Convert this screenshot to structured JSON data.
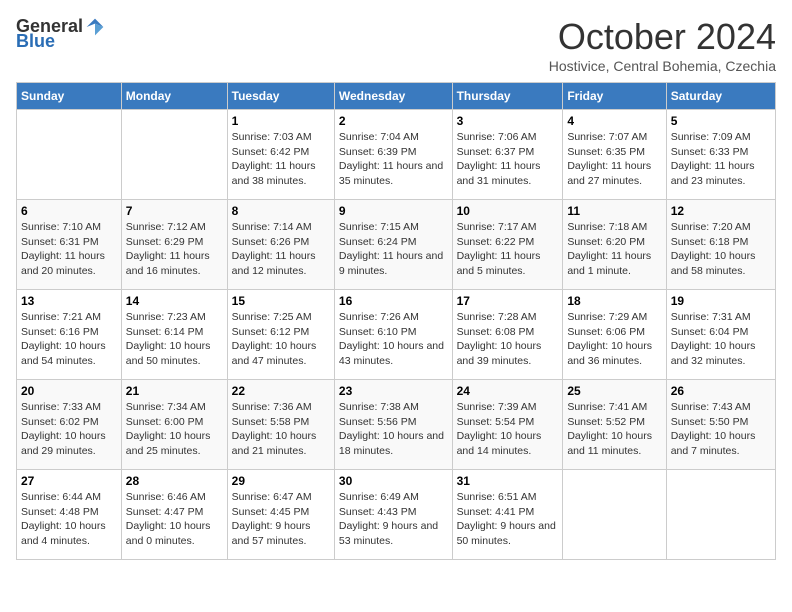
{
  "header": {
    "logo_general": "General",
    "logo_blue": "Blue",
    "month_title": "October 2024",
    "subtitle": "Hostivice, Central Bohemia, Czechia"
  },
  "days_of_week": [
    "Sunday",
    "Monday",
    "Tuesday",
    "Wednesday",
    "Thursday",
    "Friday",
    "Saturday"
  ],
  "weeks": [
    [
      {
        "day": "",
        "info": ""
      },
      {
        "day": "",
        "info": ""
      },
      {
        "day": "1",
        "info": "Sunrise: 7:03 AM\nSunset: 6:42 PM\nDaylight: 11 hours and 38 minutes."
      },
      {
        "day": "2",
        "info": "Sunrise: 7:04 AM\nSunset: 6:39 PM\nDaylight: 11 hours and 35 minutes."
      },
      {
        "day": "3",
        "info": "Sunrise: 7:06 AM\nSunset: 6:37 PM\nDaylight: 11 hours and 31 minutes."
      },
      {
        "day": "4",
        "info": "Sunrise: 7:07 AM\nSunset: 6:35 PM\nDaylight: 11 hours and 27 minutes."
      },
      {
        "day": "5",
        "info": "Sunrise: 7:09 AM\nSunset: 6:33 PM\nDaylight: 11 hours and 23 minutes."
      }
    ],
    [
      {
        "day": "6",
        "info": "Sunrise: 7:10 AM\nSunset: 6:31 PM\nDaylight: 11 hours and 20 minutes."
      },
      {
        "day": "7",
        "info": "Sunrise: 7:12 AM\nSunset: 6:29 PM\nDaylight: 11 hours and 16 minutes."
      },
      {
        "day": "8",
        "info": "Sunrise: 7:14 AM\nSunset: 6:26 PM\nDaylight: 11 hours and 12 minutes."
      },
      {
        "day": "9",
        "info": "Sunrise: 7:15 AM\nSunset: 6:24 PM\nDaylight: 11 hours and 9 minutes."
      },
      {
        "day": "10",
        "info": "Sunrise: 7:17 AM\nSunset: 6:22 PM\nDaylight: 11 hours and 5 minutes."
      },
      {
        "day": "11",
        "info": "Sunrise: 7:18 AM\nSunset: 6:20 PM\nDaylight: 11 hours and 1 minute."
      },
      {
        "day": "12",
        "info": "Sunrise: 7:20 AM\nSunset: 6:18 PM\nDaylight: 10 hours and 58 minutes."
      }
    ],
    [
      {
        "day": "13",
        "info": "Sunrise: 7:21 AM\nSunset: 6:16 PM\nDaylight: 10 hours and 54 minutes."
      },
      {
        "day": "14",
        "info": "Sunrise: 7:23 AM\nSunset: 6:14 PM\nDaylight: 10 hours and 50 minutes."
      },
      {
        "day": "15",
        "info": "Sunrise: 7:25 AM\nSunset: 6:12 PM\nDaylight: 10 hours and 47 minutes."
      },
      {
        "day": "16",
        "info": "Sunrise: 7:26 AM\nSunset: 6:10 PM\nDaylight: 10 hours and 43 minutes."
      },
      {
        "day": "17",
        "info": "Sunrise: 7:28 AM\nSunset: 6:08 PM\nDaylight: 10 hours and 39 minutes."
      },
      {
        "day": "18",
        "info": "Sunrise: 7:29 AM\nSunset: 6:06 PM\nDaylight: 10 hours and 36 minutes."
      },
      {
        "day": "19",
        "info": "Sunrise: 7:31 AM\nSunset: 6:04 PM\nDaylight: 10 hours and 32 minutes."
      }
    ],
    [
      {
        "day": "20",
        "info": "Sunrise: 7:33 AM\nSunset: 6:02 PM\nDaylight: 10 hours and 29 minutes."
      },
      {
        "day": "21",
        "info": "Sunrise: 7:34 AM\nSunset: 6:00 PM\nDaylight: 10 hours and 25 minutes."
      },
      {
        "day": "22",
        "info": "Sunrise: 7:36 AM\nSunset: 5:58 PM\nDaylight: 10 hours and 21 minutes."
      },
      {
        "day": "23",
        "info": "Sunrise: 7:38 AM\nSunset: 5:56 PM\nDaylight: 10 hours and 18 minutes."
      },
      {
        "day": "24",
        "info": "Sunrise: 7:39 AM\nSunset: 5:54 PM\nDaylight: 10 hours and 14 minutes."
      },
      {
        "day": "25",
        "info": "Sunrise: 7:41 AM\nSunset: 5:52 PM\nDaylight: 10 hours and 11 minutes."
      },
      {
        "day": "26",
        "info": "Sunrise: 7:43 AM\nSunset: 5:50 PM\nDaylight: 10 hours and 7 minutes."
      }
    ],
    [
      {
        "day": "27",
        "info": "Sunrise: 6:44 AM\nSunset: 4:48 PM\nDaylight: 10 hours and 4 minutes."
      },
      {
        "day": "28",
        "info": "Sunrise: 6:46 AM\nSunset: 4:47 PM\nDaylight: 10 hours and 0 minutes."
      },
      {
        "day": "29",
        "info": "Sunrise: 6:47 AM\nSunset: 4:45 PM\nDaylight: 9 hours and 57 minutes."
      },
      {
        "day": "30",
        "info": "Sunrise: 6:49 AM\nSunset: 4:43 PM\nDaylight: 9 hours and 53 minutes."
      },
      {
        "day": "31",
        "info": "Sunrise: 6:51 AM\nSunset: 4:41 PM\nDaylight: 9 hours and 50 minutes."
      },
      {
        "day": "",
        "info": ""
      },
      {
        "day": "",
        "info": ""
      }
    ]
  ]
}
